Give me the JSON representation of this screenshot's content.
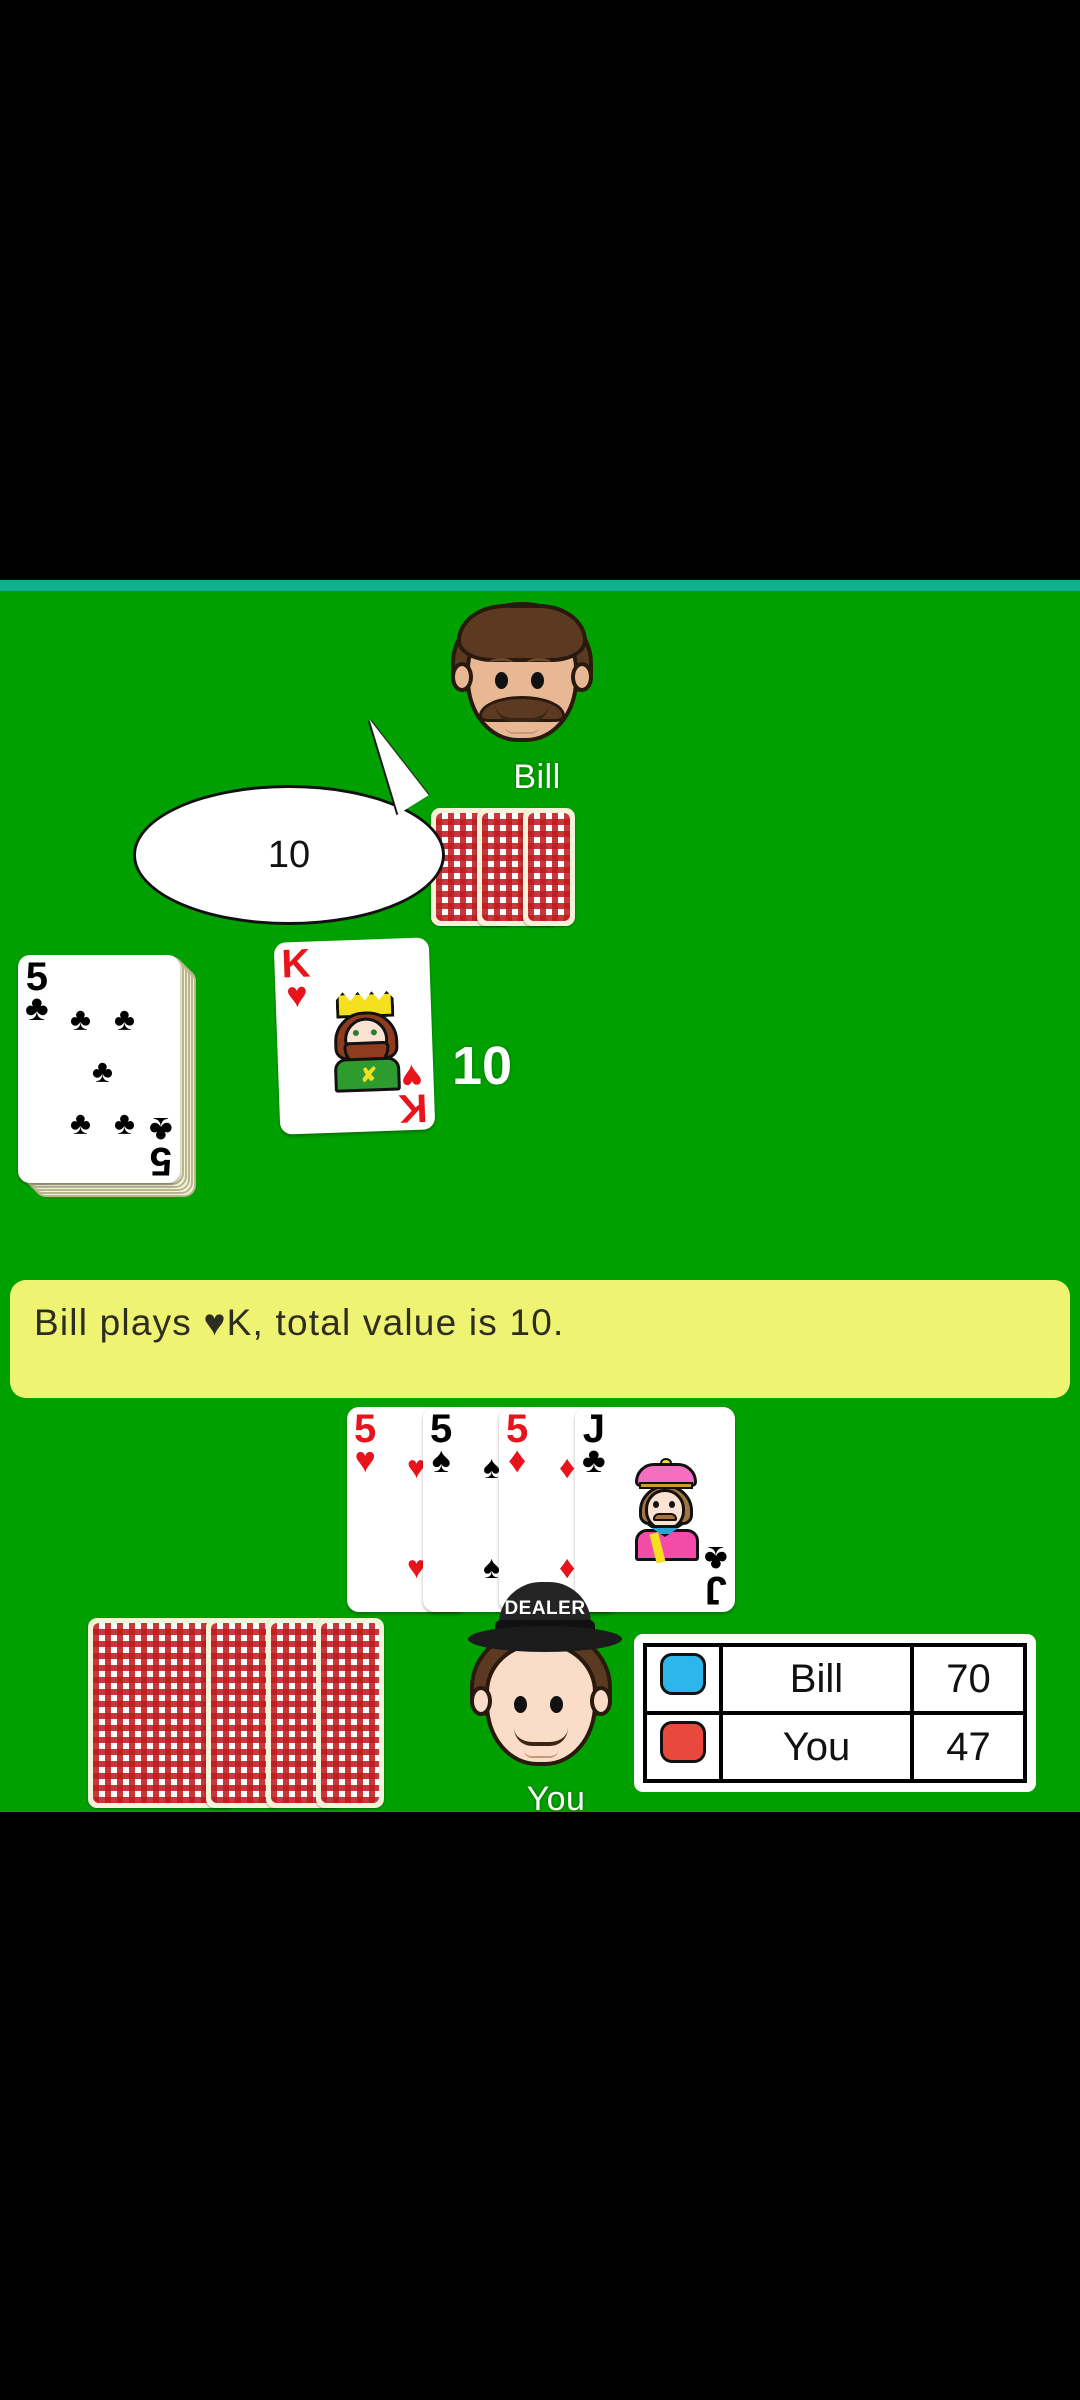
{
  "game": {
    "felt_color": "#00a000",
    "top_strip_color": "#11b08e"
  },
  "opponent": {
    "name": "Bill",
    "speech_value": "10",
    "hand_back_count": 3
  },
  "played_card": {
    "rank": "K",
    "suit": "♥",
    "suit_name": "hearts",
    "color": "red",
    "value_label": "10"
  },
  "draw_pile": {
    "top_card_rank": "5",
    "top_card_suit": "♣",
    "top_card_suit_name": "clubs",
    "color": "black",
    "stack_depth": 5
  },
  "message": {
    "text": "Bill plays ♥K, total value is 10.",
    "background": "#eef372"
  },
  "player": {
    "name": "You",
    "dealer_badge": "DEALER",
    "hand_back_count": 4,
    "hand": [
      {
        "rank": "5",
        "suit": "♥",
        "suit_name": "hearts",
        "color": "red"
      },
      {
        "rank": "5",
        "suit": "♠",
        "suit_name": "spades",
        "color": "black"
      },
      {
        "rank": "5",
        "suit": "♦",
        "suit_name": "diamonds",
        "color": "red"
      },
      {
        "rank": "J",
        "suit": "♣",
        "suit_name": "clubs",
        "color": "black"
      }
    ]
  },
  "scoreboard": {
    "rows": [
      {
        "player": "Bill",
        "score": "70",
        "color": "#2cb6ec"
      },
      {
        "player": "You",
        "score": "47",
        "color": "#e8493c"
      }
    ]
  }
}
